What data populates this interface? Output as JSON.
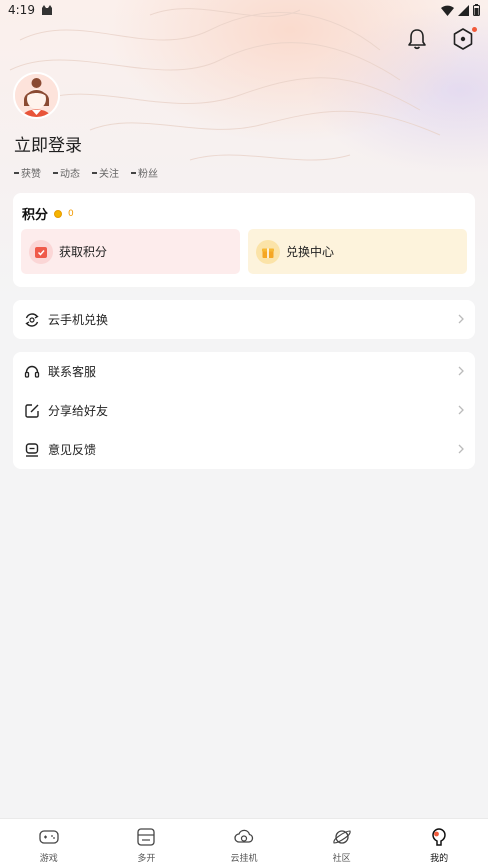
{
  "status_bar": {
    "time": "4:19"
  },
  "header": {
    "login_text": "立即登录"
  },
  "stats": [
    {
      "label": "获赞"
    },
    {
      "label": "动态"
    },
    {
      "label": "关注"
    },
    {
      "label": "粉丝"
    }
  ],
  "points": {
    "title": "积分",
    "value": "0",
    "earn_label": "获取积分",
    "shop_label": "兑换中心"
  },
  "cloud": {
    "label": "云手机兑换"
  },
  "menu": {
    "items": [
      {
        "label": "联系客服",
        "icon": "headset-icon"
      },
      {
        "label": "分享给好友",
        "icon": "share-icon"
      },
      {
        "label": "意见反馈",
        "icon": "feedback-icon"
      }
    ]
  },
  "tabs": [
    {
      "label": "游戏",
      "icon": "gamepad-icon"
    },
    {
      "label": "多开",
      "icon": "multi-open-icon"
    },
    {
      "label": "云挂机",
      "icon": "cloud-hangup-icon"
    },
    {
      "label": "社区",
      "icon": "planet-icon"
    },
    {
      "label": "我的",
      "icon": "profile-icon",
      "active": true
    }
  ],
  "colors": {
    "accent_orange": "#f29a00",
    "notify_red": "#f15a3a",
    "earn_bg": "#fdecec",
    "shop_bg": "#fdf3dc"
  }
}
